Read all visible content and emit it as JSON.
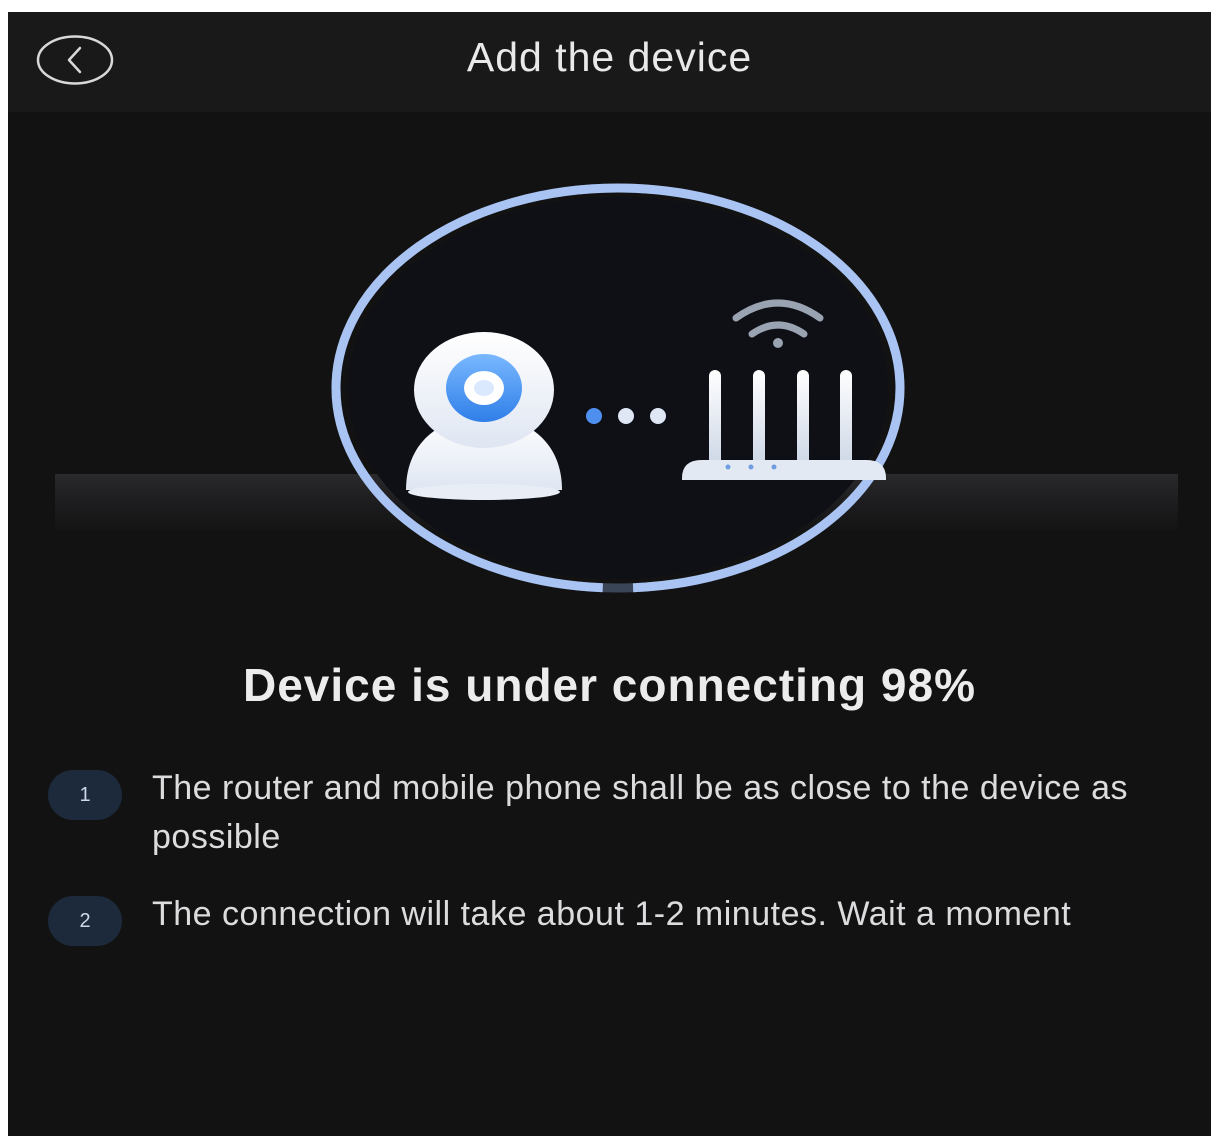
{
  "header": {
    "title": "Add the device",
    "back_icon": "chevron-left-circle-icon"
  },
  "progress": {
    "percent": 98,
    "status_text": "Device is under connecting 98%"
  },
  "illustration": {
    "camera_icon": "camera-icon",
    "router_icon": "router-icon",
    "wifi_icon": "wifi-icon",
    "ring_color": "#a9c4f2",
    "accent_color": "#3d8ef0"
  },
  "tips": [
    {
      "number": "1",
      "text": "The router and mobile phone shall be as close to the device as possible"
    },
    {
      "number": "2",
      "text": "The connection will take about 1-2 minutes. Wait a moment"
    }
  ]
}
